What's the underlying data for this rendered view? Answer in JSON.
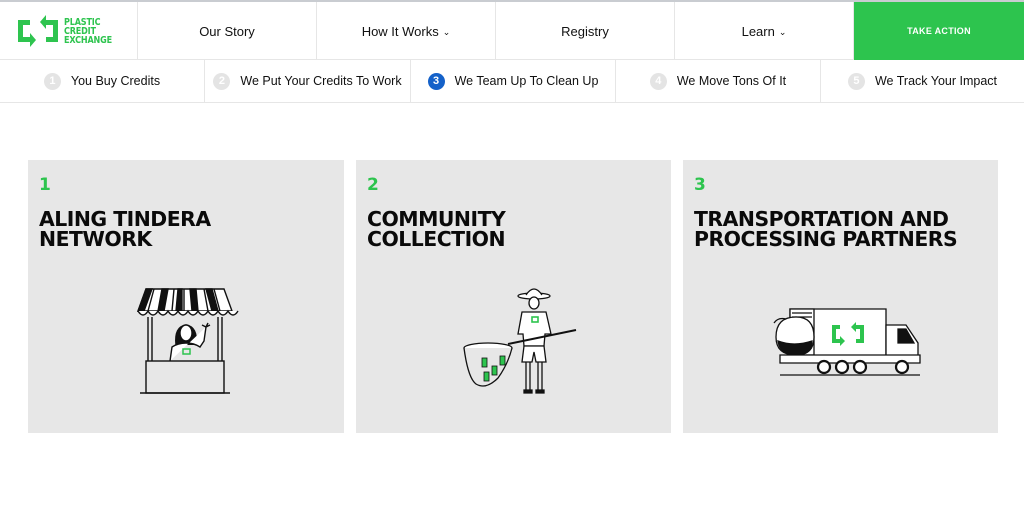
{
  "header": {
    "logo": {
      "lines": [
        "PLASTIC",
        "CREDIT",
        "EXCHANGE"
      ],
      "icon": "exchange-arrows-icon"
    },
    "nav": [
      {
        "label": "Our Story",
        "dropdown": false
      },
      {
        "label": "How It Works",
        "dropdown": true
      },
      {
        "label": "Registry",
        "dropdown": false
      },
      {
        "label": "Learn",
        "dropdown": true
      }
    ],
    "chevron": "⌄",
    "cta_label": "TAKE ACTION"
  },
  "steps": [
    {
      "num": "1",
      "label": "You Buy Credits",
      "active": false
    },
    {
      "num": "2",
      "label": "We Put Your Credits To Work",
      "active": false
    },
    {
      "num": "3",
      "label": "We Team Up To Clean Up",
      "active": true
    },
    {
      "num": "4",
      "label": "We Move Tons Of It",
      "active": false
    },
    {
      "num": "5",
      "label": "We Track Your Impact",
      "active": false
    }
  ],
  "cards": [
    {
      "num": "1",
      "title_line1": "ALING TINDERA",
      "title_line2": "NETWORK",
      "illustration": "sari-sari-store-vendor"
    },
    {
      "num": "2",
      "title_line1": "COMMUNITY",
      "title_line2": "COLLECTION",
      "illustration": "collector-with-net"
    },
    {
      "num": "3",
      "title_line1": "TRANSPORTATION AND",
      "title_line2": "PROCESSING PARTNERS",
      "illustration": "recycling-truck"
    }
  ],
  "colors": {
    "brand_green": "#2dc44e",
    "active_step_blue": "#1461c9",
    "card_bg": "#e7e7e7"
  }
}
